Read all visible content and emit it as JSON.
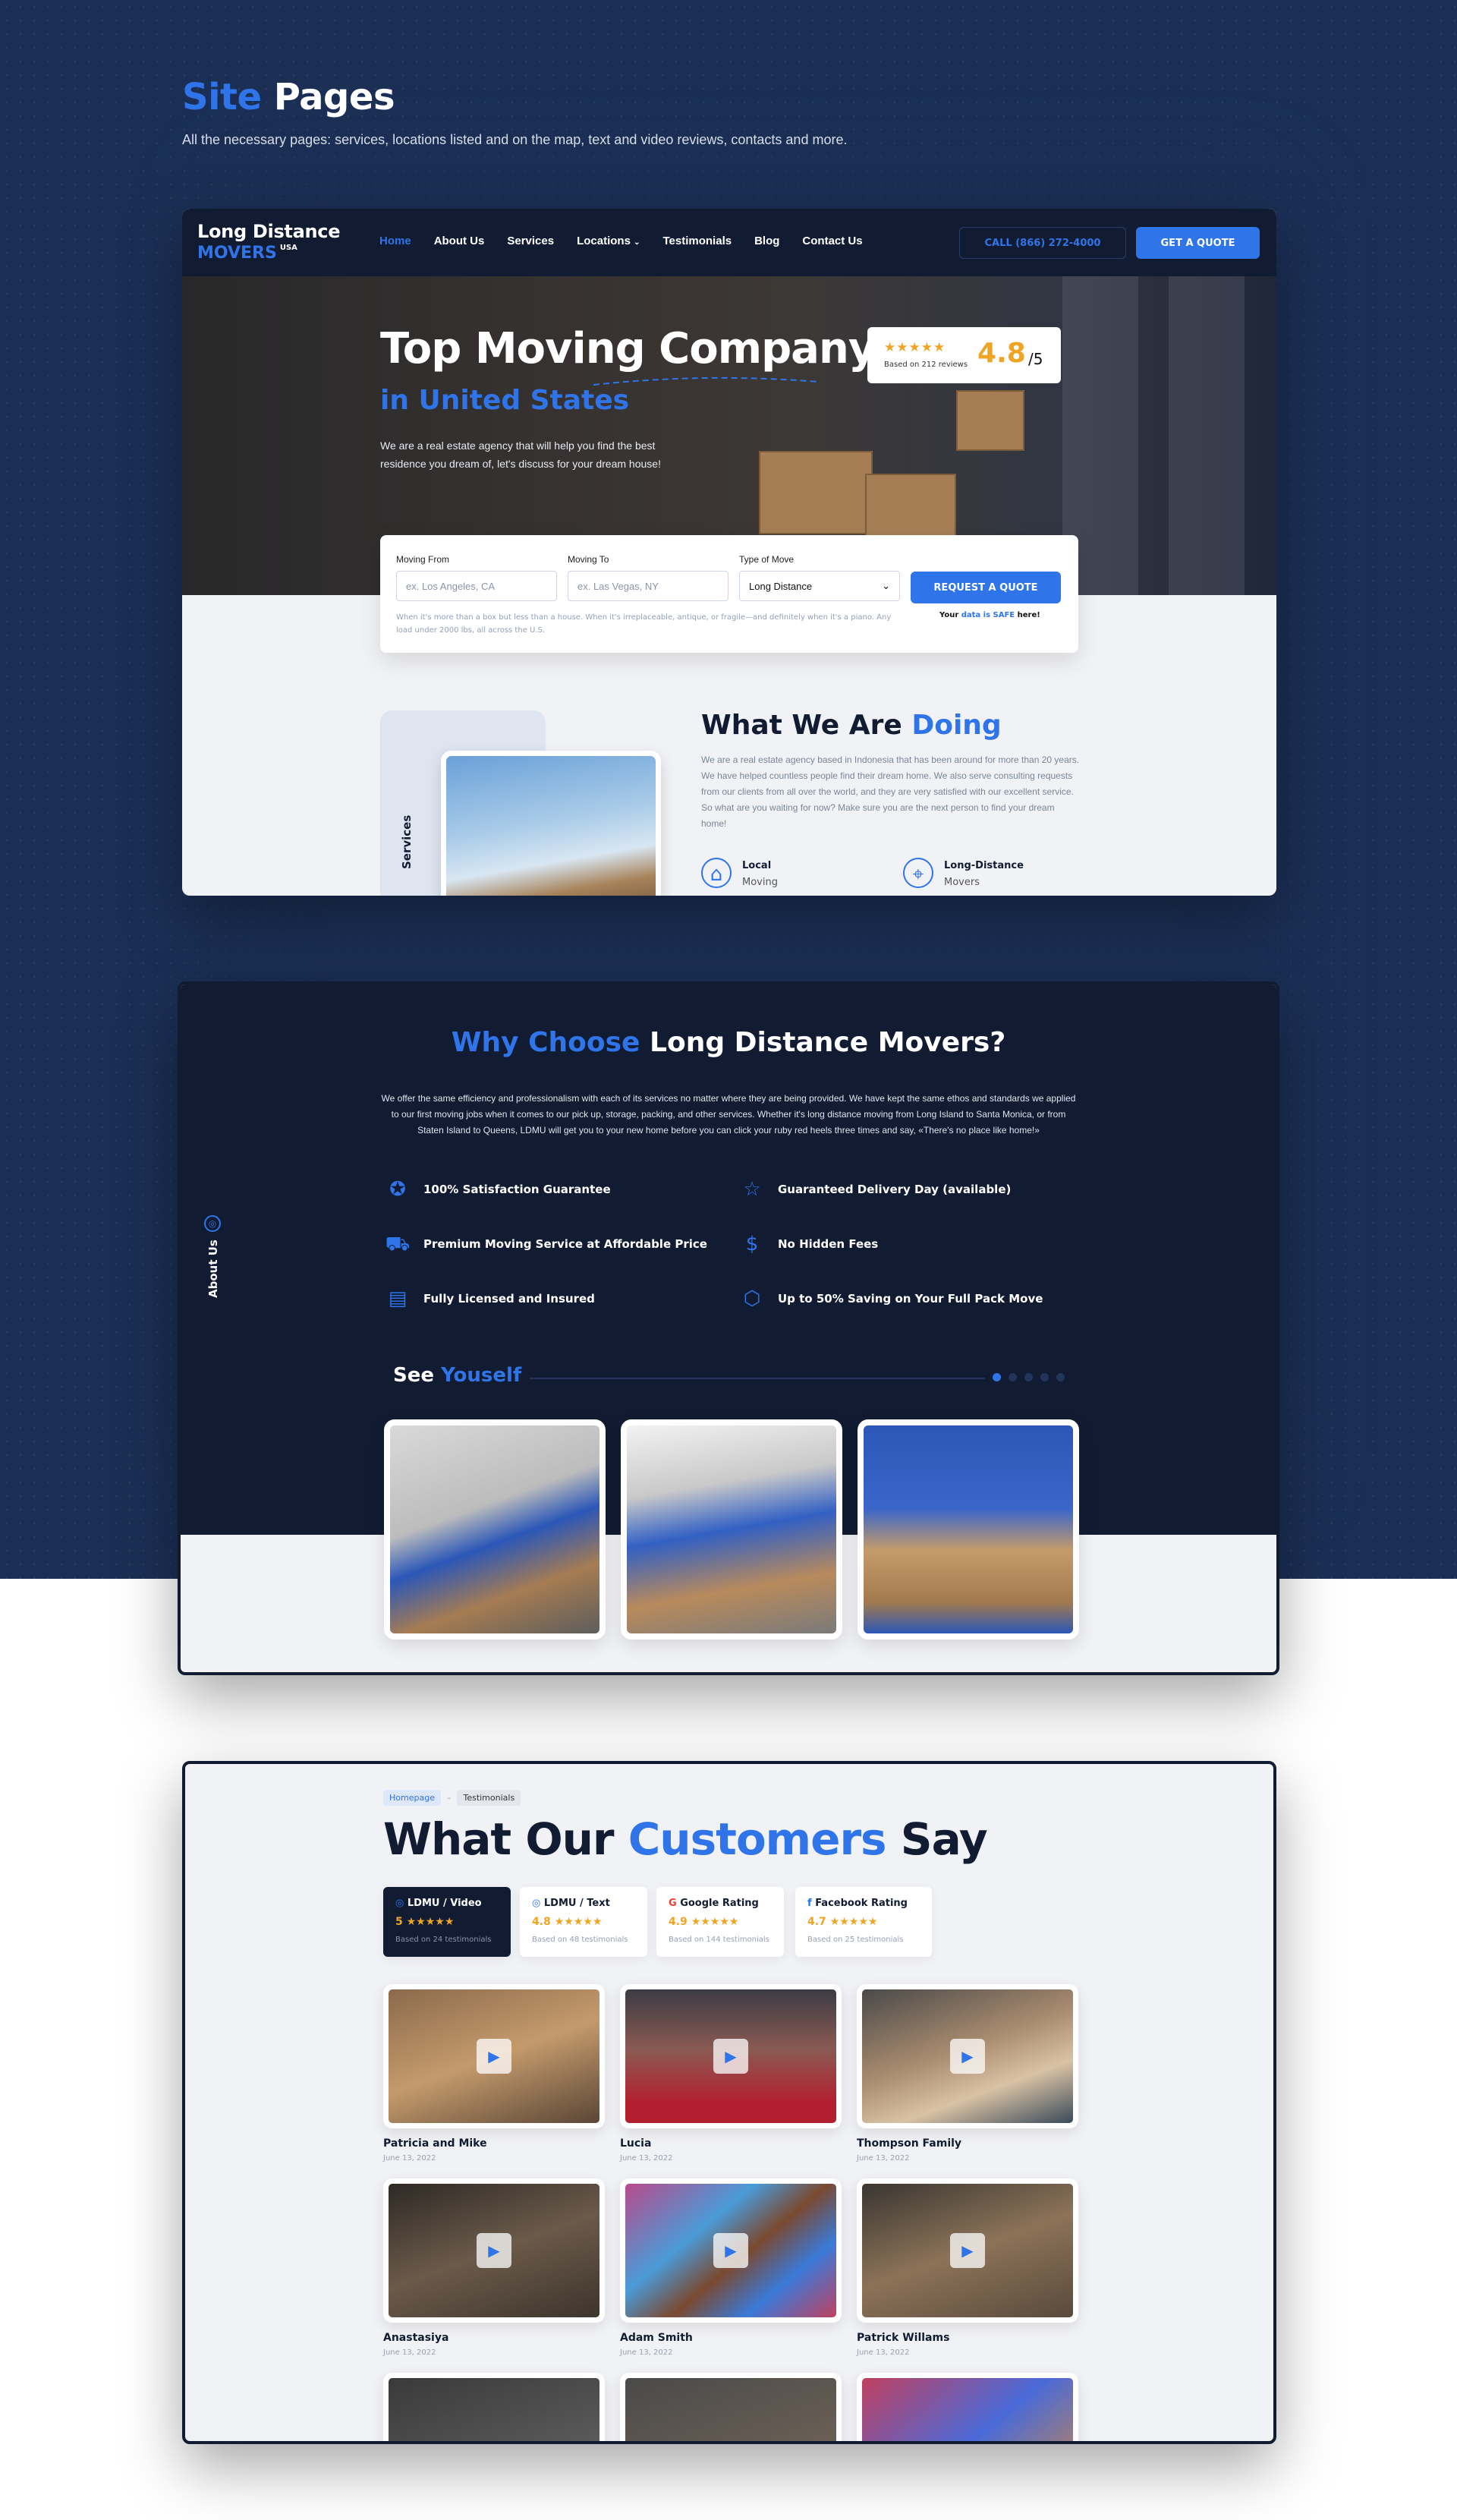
{
  "header": {
    "title_accent": "Site",
    "title_rest": "Pages",
    "subtitle": "All the necessary pages: services, locations listed and on the map, text and video reviews, contacts and more."
  },
  "nav": {
    "logo_line1": "Long Distance",
    "logo_line2": "MOVERS",
    "logo_badge": "USA",
    "links": [
      "Home",
      "About Us",
      "Services",
      "Locations",
      "Testimonials",
      "Blog",
      "Contact Us"
    ],
    "call_label": "CALL (866) 272-4000",
    "quote_label": "GET A QUOTE"
  },
  "hero": {
    "title": "Top Moving Company",
    "subtitle": "in United States",
    "text": "We are a real estate agency that will help you find the best residence you dream of, let's discuss for your dream house!",
    "rating_stars": "★★★★★",
    "rating_based": "Based on 212 reviews",
    "rating_score": "4.8",
    "rating_of": "/5"
  },
  "quote_form": {
    "from_label": "Moving From",
    "from_placeholder": "ex. Los Angeles, CA",
    "to_label": "Moving To",
    "to_placeholder": "ex. Las Vegas, NY",
    "type_label": "Type of Move",
    "type_value": "Long Distance",
    "submit_label": "REQUEST A QUOTE",
    "note": "When it's more than a box but less than a house. When it's irreplaceable, antique, or fragile—and definitely when it's a piano. Any load under 2000 lbs, all across the U.S.",
    "safe_prefix": "Your",
    "safe_accent": "data is SAFE",
    "safe_suffix": "here!"
  },
  "doing": {
    "title": "What We Are",
    "title_accent": "Doing",
    "vertical_label": "Services",
    "text": "We are a real estate agency based in Indonesia that has been around for more than 20 years. We have helped countless people find their dream home. We also serve consulting requests from our clients from all over the world, and they are very satisfied with our excellent service. So what are you waiting for now? Make sure you are the next person to find your dream home!",
    "services": [
      {
        "title": "Local",
        "subtitle": "Moving"
      },
      {
        "title": "Long-Distance",
        "subtitle": "Movers"
      }
    ]
  },
  "why": {
    "title_accent": "Why Choose",
    "title_rest": "Long Distance Movers?",
    "text": "We offer the same efficiency and professionalism with each of its services no matter where they are being provided. We have kept the same ethos and standards we applied to our first moving jobs when it comes to our pick up, storage, packing, and other services. Whether it's long distance moving from Long Island to Santa Monica, or from Staten Island to Queens, LDMU will get you to your new home before you can click your ruby red heels three times and say, «There's no place like home!»",
    "vertical_label": "About Us",
    "features": [
      "100% Satisfaction Guarantee",
      "Guaranteed Delivery Day (available)",
      "Premium Moving Service at Affordable Price",
      "No Hidden Fees",
      "Fully Licensed and Insured",
      "Up to 50% Saving on Your Full Pack Move"
    ],
    "see_title": "See",
    "see_accent": "Youself"
  },
  "testimonials": {
    "breadcrumb": [
      "Homepage",
      "Testimonials"
    ],
    "title_pre": "What Our",
    "title_accent": "Customers",
    "title_post": "Say",
    "tabs": [
      {
        "label": "LDMU / Video",
        "score": "5",
        "basis": "Based on 24 testimonials"
      },
      {
        "label": "LDMU / Text",
        "score": "4.8",
        "basis": "Based on 48 testimonials"
      },
      {
        "label": "Google Rating",
        "score": "4.9",
        "basis": "Based on 144 testimonials"
      },
      {
        "label": "Facebook Rating",
        "score": "4.7",
        "basis": "Based on 25 testimonials"
      }
    ],
    "stars": "★★★★★",
    "videos": [
      {
        "name": "Patricia and Mike",
        "date": "June 13, 2022"
      },
      {
        "name": "Lucia",
        "date": "June 13, 2022"
      },
      {
        "name": "Thompson Family",
        "date": "June 13, 2022"
      },
      {
        "name": "Anastasiya",
        "date": "June 13, 2022"
      },
      {
        "name": "Adam Smith",
        "date": "June 13, 2022"
      },
      {
        "name": "Patrick Willams",
        "date": "June 13, 2022"
      }
    ]
  },
  "colors": {
    "navy": "#1b2f55",
    "dark": "#111c33",
    "accent": "#2f74e8",
    "star": "#f0a423"
  }
}
